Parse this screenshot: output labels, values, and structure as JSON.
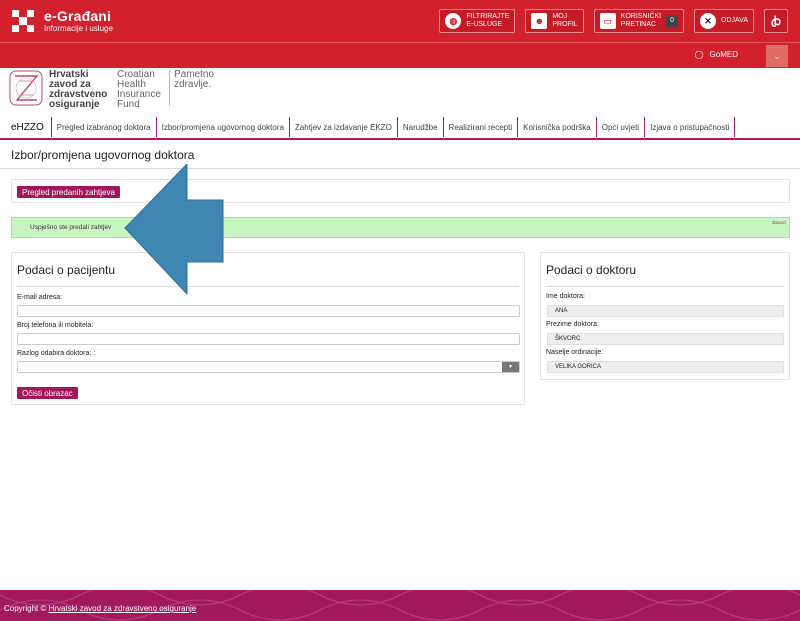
{
  "header": {
    "brand_title": "e-Građani",
    "brand_subtitle": "Informacije i usluge",
    "filter_label_1": "FILTRIRAJTE",
    "filter_label_2": "E-USLUGE",
    "profile_label_1": "MOJ",
    "profile_label_2": "PROFIL",
    "inbox_label_1": "KORISNIČKI",
    "inbox_label_2": "PRETINAC",
    "inbox_count": "0",
    "logout_label": "ODJAVA",
    "lang_label": "ꞗ"
  },
  "userbar": {
    "username": "GoMED"
  },
  "hzzo": {
    "name_hr": "Hrvatski zavod za zdravstveno osiguranje",
    "name_en": "Croatian Health Insurance Fund",
    "slogan": "Pametno zdravlje."
  },
  "nav": {
    "home": "eHZZO",
    "items": [
      "Pregled izabranog doktora",
      "Izbor/promjena ugovornog doktora",
      "Zahtjev za izdavanje EKZO",
      "Narudžbe",
      "Realizirani recepti",
      "Korisnička podrška",
      "Opći uvjeti",
      "Izjava o pristupačnosti"
    ]
  },
  "page": {
    "title": "Izbor/promjena ugovornog doktora",
    "submitted_button": "Pregled predanih zahtjeva",
    "alert_text": "Uspješno ste predali zahtjev",
    "alert_close": "Zatvori"
  },
  "patient": {
    "title": "Podaci o pacijentu",
    "email_label": "E-mail adresa:",
    "email_value": "",
    "phone_label": "Broj telefona ili mobitela:",
    "phone_value": "",
    "reason_label": "Razlog odabira doktora: :",
    "reason_value": "",
    "clear_button": "Očisti obrazac"
  },
  "doctor": {
    "title": "Podaci o doktoru",
    "first_name_label": "Ime doktora:",
    "first_name_value": "ANA",
    "last_name_label": "Prezime doktora:",
    "last_name_value": "ŠKVORC",
    "place_label": "Naselje ordinacije:",
    "place_value": "VELIKA GORICA"
  },
  "footer": {
    "copyright": "Copyright ©",
    "link": "Hrvatski zavod za zdravstveno osiguranje"
  },
  "colors": {
    "header_red": "#d2202c",
    "accent_magenta": "#a0175a",
    "alert_green": "#c8f6c0",
    "arrow_blue": "#3f86b3"
  }
}
